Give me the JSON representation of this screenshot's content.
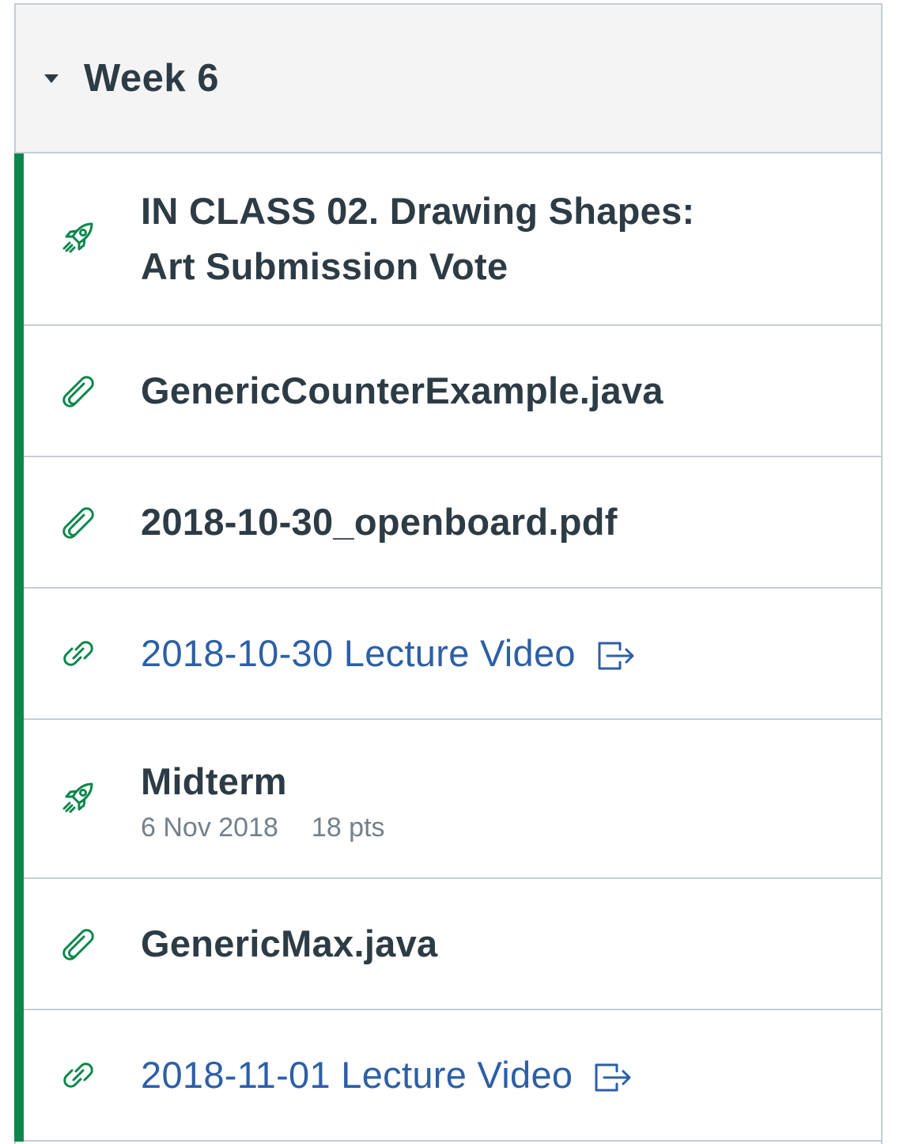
{
  "module": {
    "title": "Week 6"
  },
  "items": [
    {
      "type": "quiz",
      "icon": "rocket-icon",
      "title_line1": "IN CLASS 02. Drawing Shapes:",
      "title_line2": "Art Submission Vote"
    },
    {
      "type": "attachment",
      "icon": "paperclip-icon",
      "title": "GenericCounterExample.java"
    },
    {
      "type": "attachment",
      "icon": "paperclip-icon",
      "title": "2018-10-30_openboard.pdf"
    },
    {
      "type": "external-link",
      "icon": "link-icon",
      "title": "2018-10-30 Lecture Video",
      "ext_icon": "external-link-icon"
    },
    {
      "type": "quiz",
      "icon": "rocket-icon",
      "title": "Midterm",
      "date": "6 Nov 2018",
      "points": "18 pts"
    },
    {
      "type": "attachment",
      "icon": "paperclip-icon",
      "title": "GenericMax.java"
    },
    {
      "type": "external-link",
      "icon": "link-icon",
      "title": "2018-11-01 Lecture Video",
      "ext_icon": "external-link-icon"
    }
  ],
  "colors": {
    "accent_green": "#0b874b",
    "link_blue": "#2d5fa6",
    "text_dark": "#2d3b45",
    "meta_gray": "#73818c",
    "header_bg": "#f4f4f4",
    "border": "#c7cdd1"
  }
}
